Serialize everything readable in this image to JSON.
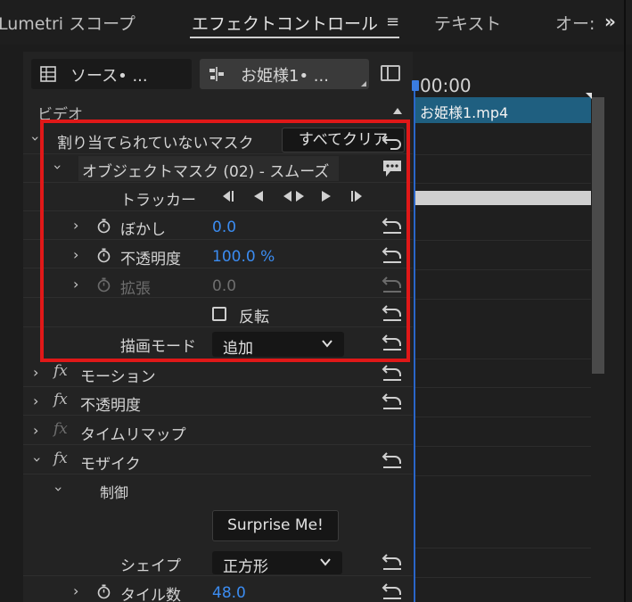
{
  "tabs": {
    "lumetri": "Lumetri スコープ",
    "effect_controls": "エフェクトコントロール",
    "text": "テキスト",
    "audio": "オー:"
  },
  "source": {
    "src_label": "ソース• ...",
    "clip_label": "お姫様1• ..."
  },
  "section": {
    "video": "ビデオ"
  },
  "mask": {
    "unassigned": "割り当てられていないマスク",
    "clear_all": "すべてクリア",
    "object_mask": "オブジェクトマスク (02) - スムーズ",
    "tracker": "トラッカー",
    "blur_label": "ぼかし",
    "blur_value": "0.0",
    "opacity_label": "不透明度",
    "opacity_value": "100.0 %",
    "expand_label": "拡張",
    "expand_value": "0.0",
    "invert_label": "反転",
    "blend_label": "描画モード",
    "blend_value": "追加"
  },
  "effects": {
    "motion": "モーション",
    "opacity": "不透明度",
    "time_remap": "タイムリマップ",
    "mosaic": "モザイク",
    "control": "制御",
    "surprise": "Surprise Me!",
    "shape_label": "シェイプ",
    "shape_value": "正方形",
    "tiles_label": "タイル数",
    "tiles_value": "48.0"
  },
  "timeline": {
    "timecode": "00:00",
    "clip_name": "お姫様1.mp4"
  },
  "colors": {
    "accent": "#3b8cf1",
    "highlight_border": "#e01818",
    "clip": "#1f5f80"
  }
}
